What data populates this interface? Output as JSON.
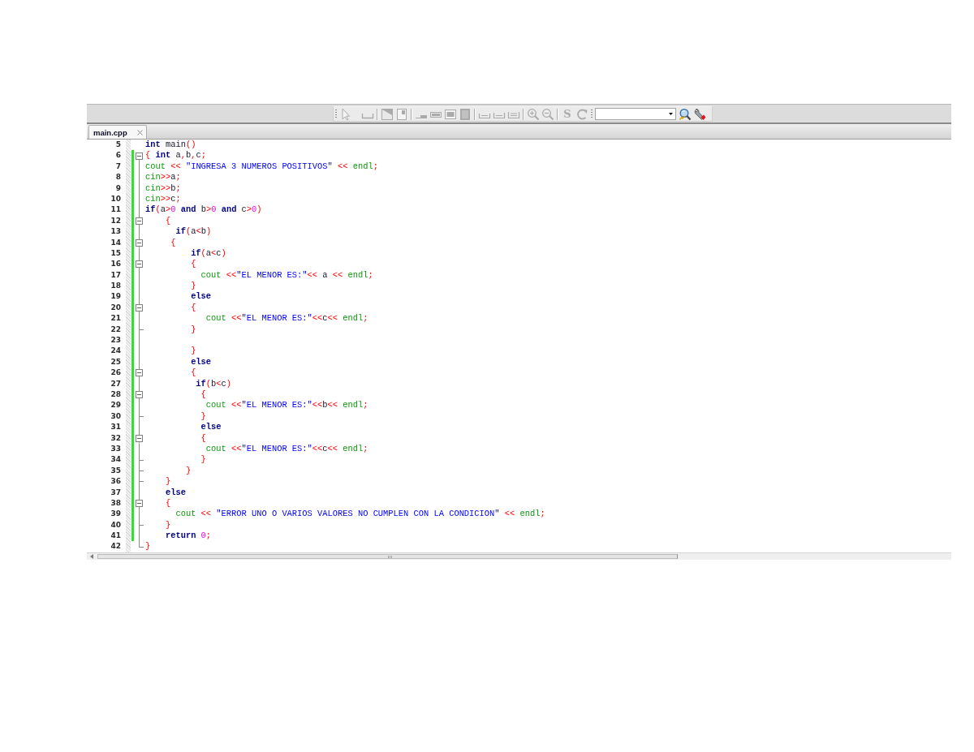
{
  "toolbar": {
    "groups": [
      {
        "buttons": [
          {
            "disabled": true
          },
          {
            "disabled": true
          }
        ]
      },
      {
        "buttons": [
          {
            "disabled": true
          },
          {
            "disabled": true
          }
        ]
      },
      {
        "buttons": [
          {
            "disabled": true
          },
          {
            "disabled": true
          },
          {
            "disabled": true
          },
          {
            "disabled": true
          }
        ]
      },
      {
        "buttons": [
          {
            "disabled": true
          },
          {
            "disabled": true
          },
          {
            "disabled": true
          }
        ]
      },
      {
        "buttons": [
          {
            "disabled": true
          },
          {
            "disabled": true
          }
        ]
      },
      {
        "buttons": [
          {
            "label": "S",
            "disabled": true
          },
          {
            "disabled": true
          }
        ]
      }
    ],
    "tools": [
      {
        "disabled": false
      },
      {
        "disabled": false
      }
    ]
  },
  "tabs": [
    {
      "label": "main.cpp",
      "selected": true
    }
  ],
  "editor": {
    "lines": [
      {
        "number": "5",
        "changed": false,
        "kind": "plain",
        "tokens": [
          {
            "kind": "keyword",
            "text": "int"
          },
          {
            "kind": "name",
            "text": " main"
          },
          {
            "kind": "symbol",
            "text": "()"
          }
        ]
      },
      {
        "number": "6",
        "changed": true,
        "kind": "opener",
        "tokens": [
          {
            "kind": "symbol",
            "text": "{"
          },
          {
            "kind": "keyword",
            "text": " int"
          },
          {
            "kind": "name",
            "text": " a"
          },
          {
            "kind": "symbol",
            "text": ","
          },
          {
            "kind": "name",
            "text": "b"
          },
          {
            "kind": "symbol",
            "text": ","
          },
          {
            "kind": "name",
            "text": "c"
          },
          {
            "kind": "symbol",
            "text": ";"
          }
        ]
      },
      {
        "number": "7",
        "changed": true,
        "kind": "inner",
        "tokens": [
          {
            "kind": "library",
            "text": "cout"
          },
          {
            "kind": "symbol",
            "text": " <<"
          },
          {
            "kind": "string",
            "text": " \"INGRESA 3 NUMEROS POSITIVOS\""
          },
          {
            "kind": "symbol",
            "text": " <<"
          },
          {
            "kind": "library",
            "text": " endl"
          },
          {
            "kind": "symbol",
            "text": ";"
          }
        ]
      },
      {
        "number": "8",
        "changed": true,
        "kind": "inner",
        "tokens": [
          {
            "kind": "library",
            "text": "cin"
          },
          {
            "kind": "symbol",
            "text": ">>"
          },
          {
            "kind": "name",
            "text": "a"
          },
          {
            "kind": "symbol",
            "text": ";"
          }
        ]
      },
      {
        "number": "9",
        "changed": true,
        "kind": "inner",
        "tokens": [
          {
            "kind": "library",
            "text": "cin"
          },
          {
            "kind": "symbol",
            "text": ">>"
          },
          {
            "kind": "name",
            "text": "b"
          },
          {
            "kind": "symbol",
            "text": ";"
          }
        ]
      },
      {
        "number": "10",
        "changed": true,
        "kind": "inner",
        "tokens": [
          {
            "kind": "library",
            "text": "cin"
          },
          {
            "kind": "symbol",
            "text": ">>"
          },
          {
            "kind": "name",
            "text": "c"
          },
          {
            "kind": "symbol",
            "text": ";"
          }
        ]
      },
      {
        "number": "11",
        "changed": true,
        "kind": "inner",
        "tokens": [
          {
            "kind": "keyword",
            "text": "if"
          },
          {
            "kind": "symbol",
            "text": "("
          },
          {
            "kind": "name",
            "text": "a"
          },
          {
            "kind": "symbol",
            "text": ">"
          },
          {
            "kind": "number",
            "text": "0"
          },
          {
            "kind": "keyword",
            "text": " and"
          },
          {
            "kind": "name",
            "text": " b"
          },
          {
            "kind": "symbol",
            "text": ">"
          },
          {
            "kind": "number",
            "text": "0"
          },
          {
            "kind": "keyword",
            "text": " and"
          },
          {
            "kind": "name",
            "text": " c"
          },
          {
            "kind": "symbol",
            "text": ">"
          },
          {
            "kind": "number",
            "text": "0"
          },
          {
            "kind": "symbol",
            "text": ")"
          }
        ]
      },
      {
        "number": "12",
        "changed": true,
        "kind": "opener",
        "tokens": [
          {
            "kind": "symbol",
            "text": "    {"
          }
        ]
      },
      {
        "number": "13",
        "changed": true,
        "kind": "inner",
        "tokens": [
          {
            "kind": "keyword",
            "text": "      if"
          },
          {
            "kind": "symbol",
            "text": "("
          },
          {
            "kind": "name",
            "text": "a"
          },
          {
            "kind": "symbol",
            "text": "<"
          },
          {
            "kind": "name",
            "text": "b"
          },
          {
            "kind": "symbol",
            "text": ")"
          }
        ]
      },
      {
        "number": "14",
        "changed": true,
        "kind": "opener",
        "tokens": [
          {
            "kind": "symbol",
            "text": "     {"
          }
        ]
      },
      {
        "number": "15",
        "changed": true,
        "kind": "inner",
        "tokens": [
          {
            "kind": "keyword",
            "text": "         if"
          },
          {
            "kind": "symbol",
            "text": "("
          },
          {
            "kind": "name",
            "text": "a"
          },
          {
            "kind": "symbol",
            "text": "<"
          },
          {
            "kind": "name",
            "text": "c"
          },
          {
            "kind": "symbol",
            "text": ")"
          }
        ]
      },
      {
        "number": "16",
        "changed": true,
        "kind": "opener",
        "tokens": [
          {
            "kind": "symbol",
            "text": "         {"
          }
        ]
      },
      {
        "number": "17",
        "changed": true,
        "kind": "inner",
        "tokens": [
          {
            "kind": "library",
            "text": "           cout"
          },
          {
            "kind": "symbol",
            "text": " <<"
          },
          {
            "kind": "string",
            "text": "\"EL MENOR ES:\""
          },
          {
            "kind": "symbol",
            "text": "<<"
          },
          {
            "kind": "name",
            "text": " a"
          },
          {
            "kind": "symbol",
            "text": " <<"
          },
          {
            "kind": "library",
            "text": " endl"
          },
          {
            "kind": "symbol",
            "text": ";"
          }
        ]
      },
      {
        "number": "18",
        "changed": true,
        "kind": "inner",
        "tokens": [
          {
            "kind": "symbol",
            "text": "         }"
          }
        ]
      },
      {
        "number": "19",
        "changed": true,
        "kind": "inner",
        "tokens": [
          {
            "kind": "keyword",
            "text": "         else"
          }
        ]
      },
      {
        "number": "20",
        "changed": true,
        "kind": "opener",
        "tokens": [
          {
            "kind": "symbol",
            "text": "         {"
          }
        ]
      },
      {
        "number": "21",
        "changed": true,
        "kind": "inner",
        "tokens": [
          {
            "kind": "library",
            "text": "            cout"
          },
          {
            "kind": "symbol",
            "text": " <<"
          },
          {
            "kind": "string",
            "text": "\"EL MENOR ES:\""
          },
          {
            "kind": "symbol",
            "text": "<<"
          },
          {
            "kind": "name",
            "text": "c"
          },
          {
            "kind": "symbol",
            "text": "<<"
          },
          {
            "kind": "library",
            "text": " endl"
          },
          {
            "kind": "symbol",
            "text": ";"
          }
        ]
      },
      {
        "number": "22",
        "changed": true,
        "kind": "closer",
        "tokens": [
          {
            "kind": "symbol",
            "text": "         }"
          }
        ]
      },
      {
        "number": "23",
        "changed": true,
        "kind": "inner"
      },
      {
        "number": "24",
        "changed": true,
        "kind": "inner",
        "tokens": [
          {
            "kind": "symbol",
            "text": "         }"
          }
        ]
      },
      {
        "number": "25",
        "changed": true,
        "kind": "inner",
        "tokens": [
          {
            "kind": "keyword",
            "text": "         else"
          }
        ]
      },
      {
        "number": "26",
        "changed": true,
        "kind": "opener",
        "tokens": [
          {
            "kind": "symbol",
            "text": "         {"
          }
        ]
      },
      {
        "number": "27",
        "changed": true,
        "kind": "inner",
        "tokens": [
          {
            "kind": "keyword",
            "text": "          if"
          },
          {
            "kind": "symbol",
            "text": "("
          },
          {
            "kind": "name",
            "text": "b"
          },
          {
            "kind": "symbol",
            "text": "<"
          },
          {
            "kind": "name",
            "text": "c"
          },
          {
            "kind": "symbol",
            "text": ")"
          }
        ]
      },
      {
        "number": "28",
        "changed": true,
        "kind": "opener",
        "tokens": [
          {
            "kind": "symbol",
            "text": "           {"
          }
        ]
      },
      {
        "number": "29",
        "changed": true,
        "kind": "inner",
        "tokens": [
          {
            "kind": "library",
            "text": "            cout"
          },
          {
            "kind": "symbol",
            "text": " <<"
          },
          {
            "kind": "string",
            "text": "\"EL MENOR ES:\""
          },
          {
            "kind": "symbol",
            "text": "<<"
          },
          {
            "kind": "name",
            "text": "b"
          },
          {
            "kind": "symbol",
            "text": "<<"
          },
          {
            "kind": "library",
            "text": " endl"
          },
          {
            "kind": "symbol",
            "text": ";"
          }
        ]
      },
      {
        "number": "30",
        "changed": true,
        "kind": "closer",
        "tokens": [
          {
            "kind": "symbol",
            "text": "           }"
          }
        ]
      },
      {
        "number": "31",
        "changed": true,
        "kind": "inner",
        "tokens": [
          {
            "kind": "keyword",
            "text": "           else"
          }
        ]
      },
      {
        "number": "32",
        "changed": true,
        "kind": "opener",
        "tokens": [
          {
            "kind": "symbol",
            "text": "           {"
          }
        ]
      },
      {
        "number": "33",
        "changed": true,
        "kind": "inner",
        "tokens": [
          {
            "kind": "library",
            "text": "            cout"
          },
          {
            "kind": "symbol",
            "text": " <<"
          },
          {
            "kind": "string",
            "text": "\"EL MENOR ES:\""
          },
          {
            "kind": "symbol",
            "text": "<<"
          },
          {
            "kind": "name",
            "text": "c"
          },
          {
            "kind": "symbol",
            "text": "<<"
          },
          {
            "kind": "library",
            "text": " endl"
          },
          {
            "kind": "symbol",
            "text": ";"
          }
        ]
      },
      {
        "number": "34",
        "changed": true,
        "kind": "closer",
        "tokens": [
          {
            "kind": "symbol",
            "text": "           }"
          }
        ]
      },
      {
        "number": "35",
        "changed": true,
        "kind": "closer",
        "tokens": [
          {
            "kind": "symbol",
            "text": "        }"
          }
        ]
      },
      {
        "number": "36",
        "changed": true,
        "kind": "closer",
        "tokens": [
          {
            "kind": "symbol",
            "text": "    }"
          }
        ]
      },
      {
        "number": "37",
        "changed": true,
        "kind": "inner",
        "tokens": [
          {
            "kind": "keyword",
            "text": "    else"
          }
        ]
      },
      {
        "number": "38",
        "changed": true,
        "kind": "opener",
        "tokens": [
          {
            "kind": "symbol",
            "text": "    {"
          }
        ]
      },
      {
        "number": "39",
        "changed": true,
        "kind": "inner",
        "tokens": [
          {
            "kind": "library",
            "text": "      cout"
          },
          {
            "kind": "symbol",
            "text": " <<"
          },
          {
            "kind": "string",
            "text": " \"ERROR UNO O VARIOS VALORES NO CUMPLEN CON LA CONDICION\""
          },
          {
            "kind": "symbol",
            "text": " <<"
          },
          {
            "kind": "library",
            "text": " endl"
          },
          {
            "kind": "symbol",
            "text": ";"
          }
        ]
      },
      {
        "number": "40",
        "changed": true,
        "kind": "closer",
        "tokens": [
          {
            "kind": "symbol",
            "text": "    }"
          }
        ]
      },
      {
        "number": "41",
        "changed": true,
        "kind": "inner",
        "tokens": [
          {
            "kind": "keyword",
            "text": "    return"
          },
          {
            "kind": "number",
            "text": " 0"
          },
          {
            "kind": "symbol",
            "text": ";"
          }
        ]
      },
      {
        "number": "42",
        "changed": false,
        "kind": "last",
        "tokens": [
          {
            "kind": "symbol",
            "text": "}"
          }
        ]
      }
    ]
  }
}
